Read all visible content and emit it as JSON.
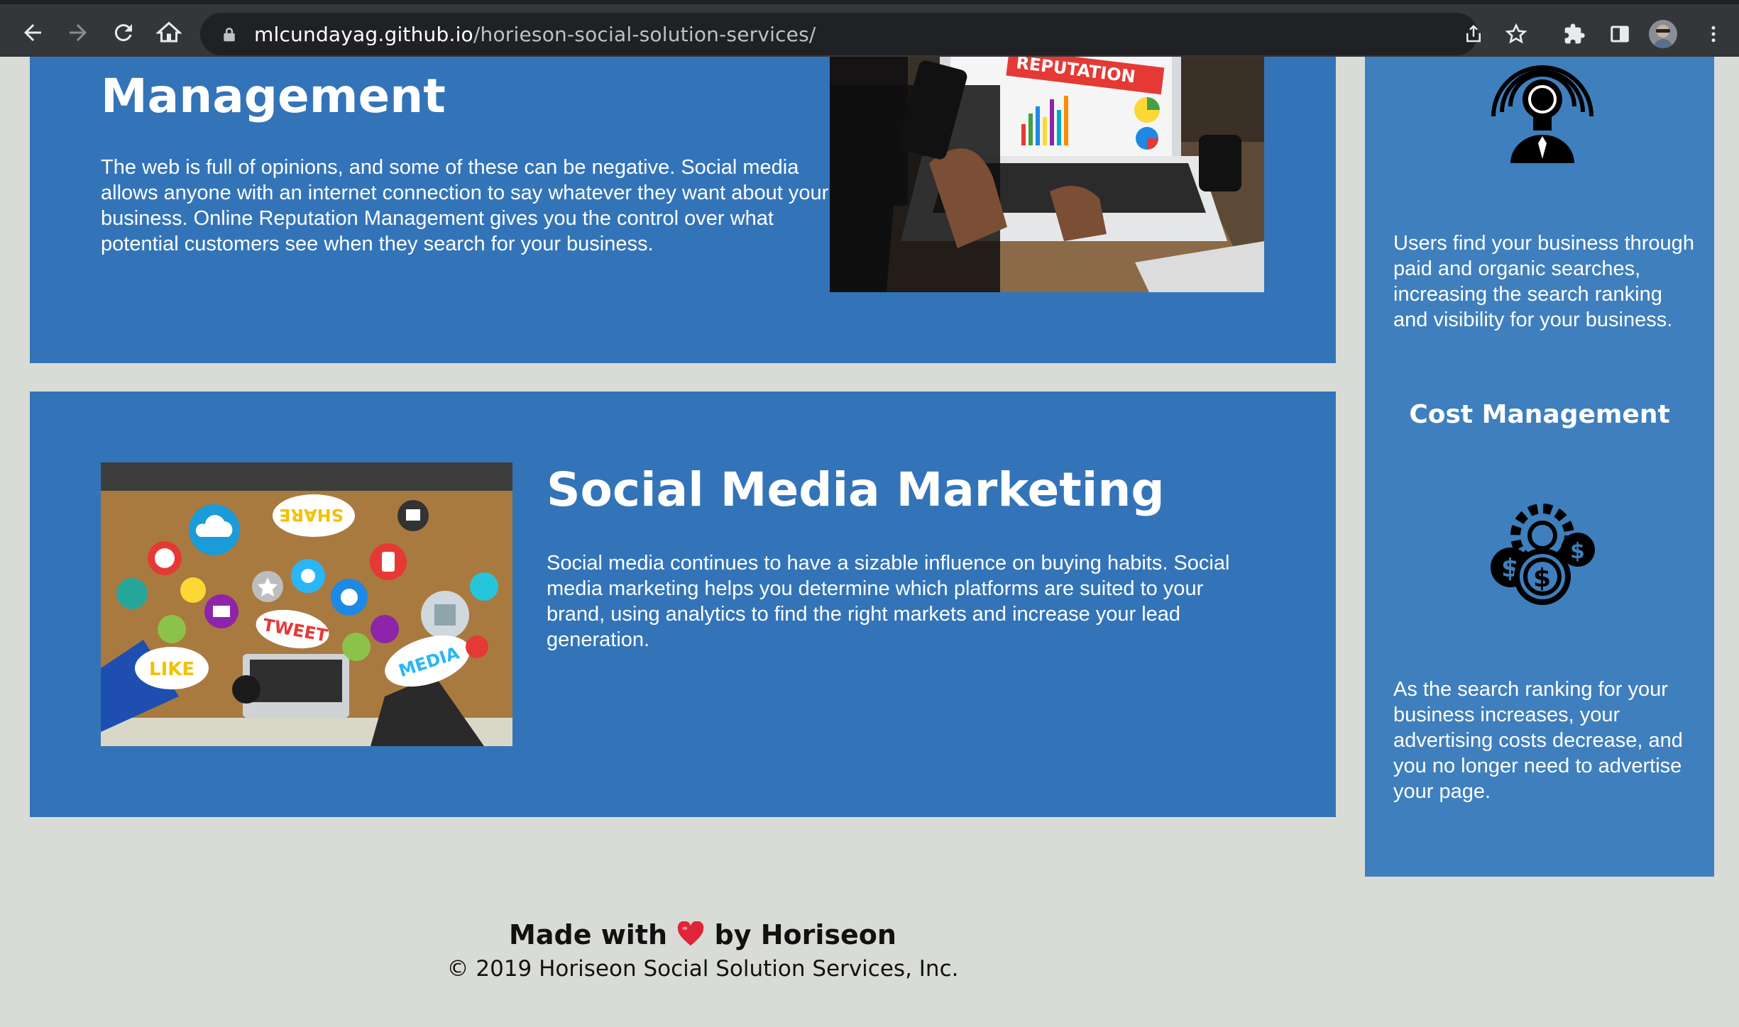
{
  "browser": {
    "url_host": "mlcundayag.github.io",
    "url_path": "/horieson-social-solution-services/"
  },
  "reputation": {
    "title": "Management",
    "body": "The web is full of opinions, and some of these can be negative. Social media allows anyone with an internet connection to say whatever they want about your business. Online Reputation Management gives you the control over what potential customers see when they search for your business.",
    "image_banner": "REPUTATION"
  },
  "social_media": {
    "title": "Social Media Marketing",
    "body": "Social media continues to have a sizable influence on buying habits. Social media marketing helps you determine which platforms are suited to your brand, using analytics to find the right markets and increase your lead generation.",
    "image_labels": [
      "SHARE",
      "TWEET",
      "LIKE",
      "MEDIA"
    ]
  },
  "aside": {
    "lead_text": "Users find your business through paid and organic searches, increasing the search ranking and visibility for your business.",
    "cost_title": "Cost Management",
    "cost_text": "As the search ranking for your business increases, your advertising costs decrease, and you no longer need to advertise your page."
  },
  "footer": {
    "made_prefix": "Made with",
    "made_suffix": "by Horiseon",
    "copyright": "© 2019 Horiseon Social Solution Services, Inc."
  },
  "colors": {
    "card_blue": "#3374b8",
    "aside_blue": "#3f7fbd",
    "page_bg": "#d9dcd6",
    "chrome_bg": "#35363a"
  }
}
